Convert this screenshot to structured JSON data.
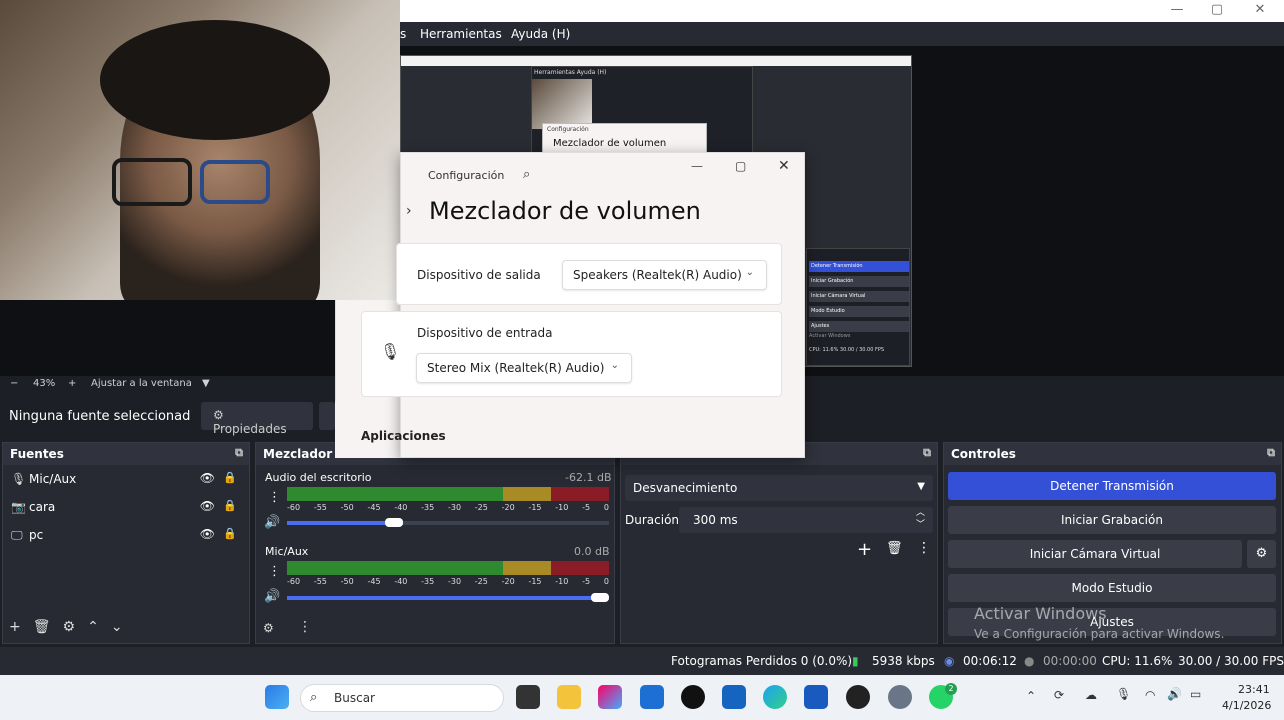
{
  "window": {
    "min": "—",
    "max": "▢",
    "close": "✕"
  },
  "menu": {
    "tools": "Herramientas",
    "help": "Ayuda (H)",
    "partial": "s"
  },
  "zoom": {
    "minus": "−",
    "level": "43%",
    "plus": "+",
    "fit": "Ajustar a la ventana",
    "arrow": "▼"
  },
  "sourcebar": {
    "none": "Ninguna fuente seleccionad",
    "properties": "Propiedades"
  },
  "sources": {
    "title": "Fuentes",
    "items": [
      {
        "name": "Mic/Aux",
        "icon": "mic-icon"
      },
      {
        "name": "cara",
        "icon": "camera-icon"
      },
      {
        "name": "pc",
        "icon": "monitor-icon"
      }
    ]
  },
  "mixer": {
    "title": "Mezclador d",
    "channels": [
      {
        "name": "Audio del escritorio",
        "db": "-62.1 dB",
        "volume": 0.36
      },
      {
        "name": "Mic/Aux",
        "db": "0.0 dB",
        "volume": 1.0
      }
    ],
    "ticks": [
      "-60",
      "-55",
      "-50",
      "-45",
      "-40",
      "-35",
      "-30",
      "-25",
      "-20",
      "-15",
      "-10",
      "-5",
      "0"
    ]
  },
  "transition": {
    "type": "Desvanecimiento",
    "duration_label": "Duración",
    "duration": "300 ms"
  },
  "controls": {
    "title": "Controles",
    "stop_stream": "Detener Transmisión",
    "start_rec": "Iniciar Grabación",
    "virtual_cam": "Iniciar Cámara Virtual",
    "studio": "Modo Estudio",
    "settings": "Ajustes"
  },
  "watermark": {
    "line1": "Activar Windows",
    "line2": "Ve a Configuración para activar Windows."
  },
  "status": {
    "dropped": "Fotogramas Perdidos 0 (0.0%)",
    "kbps": "5938 kbps",
    "stream_time": "00:06:12",
    "rec_time": "00:00:00",
    "cpu": "CPU: 11.6%",
    "fps": "30.00 / 30.00 FPS"
  },
  "dialog": {
    "app": "Configuración",
    "title": "Mezclador de volumen",
    "output_label": "Dispositivo de salida",
    "output_value": "Speakers (Realtek(R) Audio)",
    "input_label": "Dispositivo de entrada",
    "input_value": "Stereo Mix (Realtek(R) Audio)",
    "apps": "Aplicaciones"
  },
  "mini": {
    "menu": "Herramientas  Ayuda (H)",
    "config": "Configuración",
    "title": "Mezclador de volumen",
    "stop": "Detener Transmisión",
    "rec": "Iniciar Grabación",
    "vcam": "Iniciar Cámara Virtual",
    "studio": "Modo Estudio",
    "ajustes": "Ajustes",
    "win": "Activar Windows",
    "status": "CPU: 11.6%  30.00 / 30.00 FPS"
  },
  "taskbar": {
    "search": "Buscar",
    "time": "23:41",
    "date": "4/1/2026",
    "badge": "2"
  },
  "colors": {
    "accent": "#3450d6",
    "panel": "#272a33",
    "bg": "#1d1f26"
  }
}
